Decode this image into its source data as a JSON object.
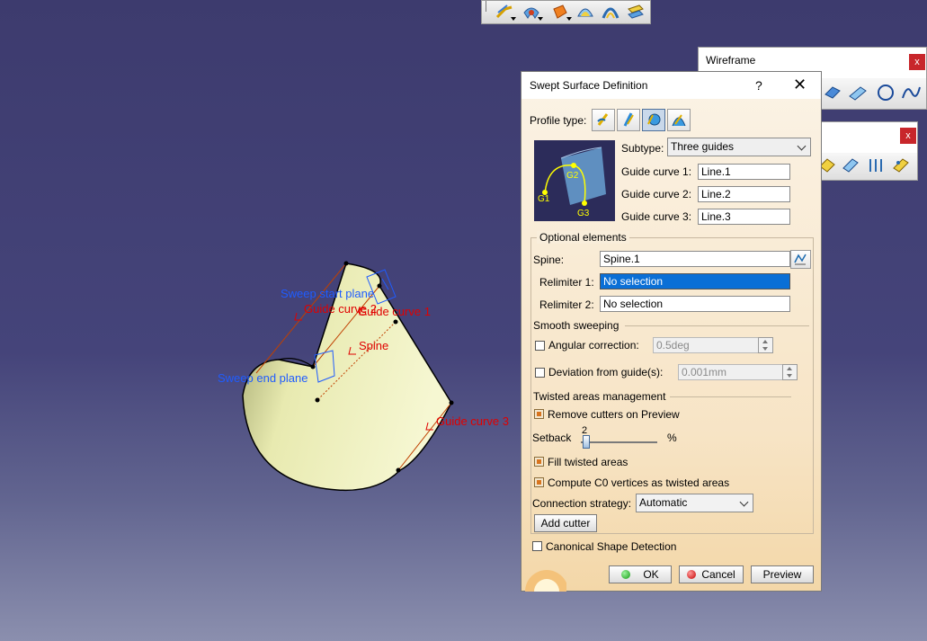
{
  "toolbar_top": {
    "icons": [
      "sweep-icon",
      "fill-icon",
      "extrude-icon",
      "blend-icon",
      "offset-icon",
      "multisection-icon"
    ]
  },
  "wireframe_toolbar": {
    "title": "Wireframe",
    "close_label": "x"
  },
  "second_toolbar": {
    "close_label": "x"
  },
  "dialog": {
    "title": "Swept Surface Definition",
    "help_label": "?",
    "close_label": "✕",
    "profile_type_label": "Profile type:",
    "subtype_label": "Subtype:",
    "subtype_value": "Three guides",
    "preview_labels": [
      "G1",
      "G2",
      "G3"
    ],
    "guide1_label": "Guide curve 1:",
    "guide1_value": "Line.1",
    "guide2_label": "Guide curve 2:",
    "guide2_value": "Line.2",
    "guide3_label": "Guide curve 3:",
    "guide3_value": "Line.3",
    "optional_label": "Optional elements",
    "spine_label": "Spine:",
    "spine_value": "Spine.1",
    "relimiter1_label": "Relimiter 1:",
    "relimiter1_value": "No selection",
    "relimiter2_label": "Relimiter 2:",
    "relimiter2_value": "No selection",
    "smooth_label": "Smooth sweeping",
    "angular_label": "Angular correction:",
    "angular_value": "0.5deg",
    "deviation_label": "Deviation from guide(s):",
    "deviation_value": "0.001mm",
    "twisted_label": "Twisted areas management",
    "remove_cutters_label": "Remove cutters on Preview",
    "setback_label": "Setback",
    "setback_value": "2",
    "setback_unit": "%",
    "fill_twisted_label": "Fill twisted areas",
    "compute_c0_label": "Compute C0 vertices as twisted areas",
    "connection_label": "Connection strategy:",
    "connection_value": "Automatic",
    "add_cutter_label": "Add cutter",
    "canonical_label": "Canonical Shape Detection",
    "ok_label": "OK",
    "cancel_label": "Cancel",
    "preview_label": "Preview"
  },
  "viewport": {
    "sweep_start_plane": "Sweep start plane",
    "guide_curve_2": "Guide curve 2",
    "guide_curve_1": "Guide curve 1",
    "spine": "Spine",
    "sweep_end_plane": "Sweep end plane",
    "guide_curve_3": "Guide curve 3"
  },
  "colors": {
    "background_top": "#3d3b6e",
    "surface_fill": "#e8eab0",
    "blue_label": "#1f5cff",
    "red_label": "#e00000",
    "selection": "#0a6fd6"
  }
}
